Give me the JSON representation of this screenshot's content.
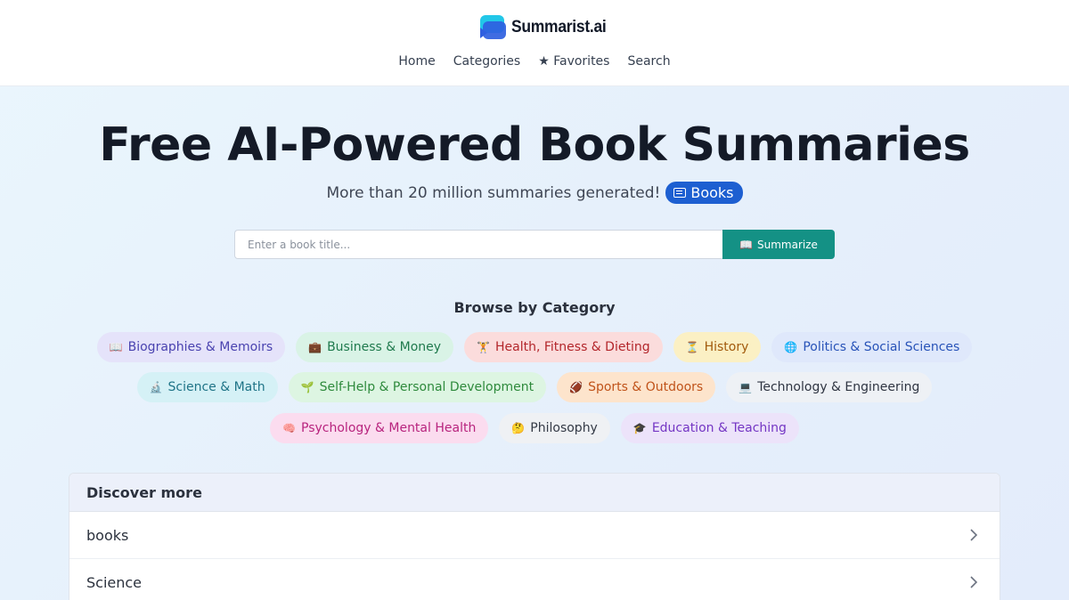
{
  "brand": {
    "name": "Summarist.ai"
  },
  "nav": [
    {
      "label": "Home"
    },
    {
      "label": "Categories"
    },
    {
      "label": "★ Favorites"
    },
    {
      "label": "Search"
    }
  ],
  "hero": {
    "title": "Free AI-Powered Book Summaries",
    "subtitle": "More than 20 million summaries generated!",
    "badge_label": "Books"
  },
  "search": {
    "placeholder": "Enter a book title...",
    "button_icon": "📖",
    "button_label": "Summarize"
  },
  "browse": {
    "title": "Browse by Category",
    "rows": [
      [
        {
          "icon": "📖",
          "label": "Biographies & Memoirs",
          "bg": "#e5e3fa",
          "fg": "#4a43b0"
        },
        {
          "icon": "💼",
          "label": "Business & Money",
          "bg": "#d9f3e6",
          "fg": "#1f7a4d"
        },
        {
          "icon": "🏋",
          "label": "Health, Fitness & Dieting",
          "bg": "#fbdcdc",
          "fg": "#b3262b"
        },
        {
          "icon": "⏳",
          "label": "History",
          "bg": "#fbf0c4",
          "fg": "#a25b0d"
        },
        {
          "icon": "🌐",
          "label": "Politics & Social Sciences",
          "bg": "#dfe8fb",
          "fg": "#2853b8"
        }
      ],
      [
        {
          "icon": "🔬",
          "label": "Science & Math",
          "bg": "#d5f1f6",
          "fg": "#1f7487"
        },
        {
          "icon": "🌱",
          "label": "Self-Help & Personal Development",
          "bg": "#ddf5e2",
          "fg": "#2e8a3c"
        },
        {
          "icon": "🏈",
          "label": "Sports & Outdoors",
          "bg": "#fde4cc",
          "fg": "#c0531a"
        },
        {
          "icon": "💻",
          "label": "Technology & Engineering",
          "bg": "#eef1f5",
          "fg": "#2f3542"
        }
      ],
      [
        {
          "icon": "🧠",
          "label": "Psychology & Mental Health",
          "bg": "#fbdcef",
          "fg": "#b8247e"
        },
        {
          "icon": "🤔",
          "label": "Philosophy",
          "bg": "#eff1f4",
          "fg": "#343a46"
        },
        {
          "icon": "🎓",
          "label": "Education & Teaching",
          "bg": "#ece3fa",
          "fg": "#7436c4"
        }
      ]
    ]
  },
  "discover": {
    "title": "Discover more",
    "items": [
      {
        "label": "books"
      },
      {
        "label": "Science"
      }
    ]
  }
}
